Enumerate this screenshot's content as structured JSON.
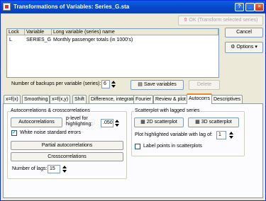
{
  "window": {
    "title": "Transformations of Variables: Series_G.sta"
  },
  "buttons": {
    "ok": "OK (Transform selected series)",
    "cancel": "Cancel",
    "options": "Options",
    "save_variables": "Save variables",
    "delete": "Delete"
  },
  "table": {
    "headers": [
      "Lock",
      "Variable",
      "Long variable (series) name"
    ],
    "rows": [
      {
        "lock": "L",
        "variable": "SERIES_G",
        "name": "Monthly passenger totals (in 1000's)"
      }
    ]
  },
  "backups": {
    "label": "Number of backups per variable (series):",
    "value": "6"
  },
  "tabs": [
    "x=f(x)",
    "Smoothing",
    "x=f(x,y)",
    "Shift",
    "Difference, integrate",
    "Fourier",
    "Review & plot",
    "Autocorrs",
    "Descriptives"
  ],
  "active_tab": "Autocorrs",
  "autocorr": {
    "group_label": "Autocorrelations & crosscorrelations",
    "autocorrelations_btn": "Autocorrelations",
    "plevel_label": "p-level for highlighting:",
    "plevel_value": ".050",
    "white_noise_label": "White noise standard errors",
    "white_noise_checked": true,
    "partial_btn": "Partial autocorrelations",
    "cross_btn": "Crosscorrelations",
    "lags_label": "Number of lags:",
    "lags_value": "15"
  },
  "scatter": {
    "group_label": "Scatterplot with lagged series",
    "btn_2d": "2D scatterplot",
    "btn_3d": "3D scatterplot",
    "lag_label": "Plot highlighted variable with lag of:",
    "lag_value": "1",
    "label_points": "Label points in scatterplots",
    "label_points_checked": false
  },
  "icons": [
    "statistica-app-icon",
    "help-icon",
    "minimize-icon",
    "close-icon",
    "ok-arrow-icon",
    "options-icon",
    "save-icon",
    "scatter-2d-icon",
    "scatter-3d-icon"
  ]
}
